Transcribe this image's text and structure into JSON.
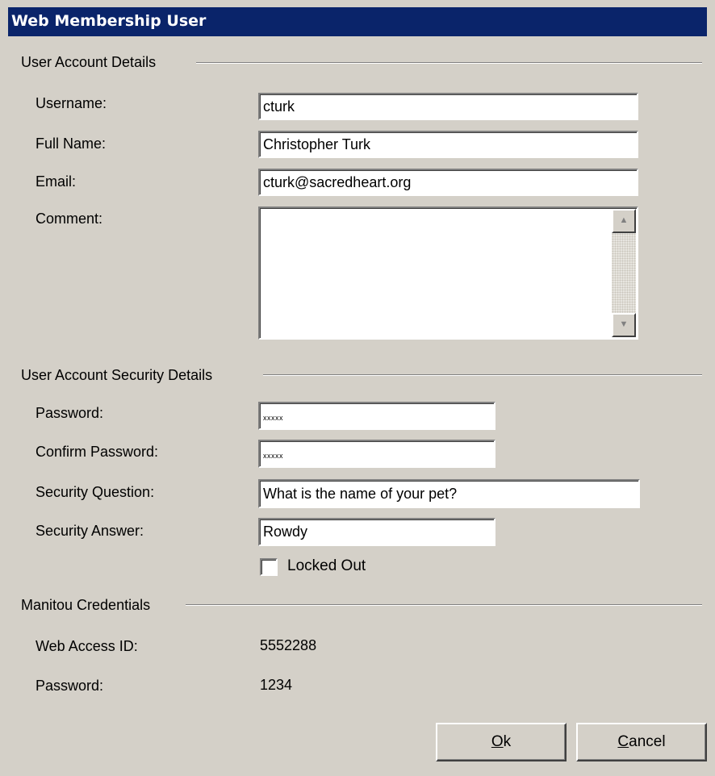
{
  "window": {
    "title": "Web Membership User"
  },
  "account_details": {
    "section_title": "User Account Details",
    "username_label": "Username:",
    "username_value": "cturk",
    "fullname_label": "Full Name:",
    "fullname_value": "Christopher Turk",
    "email_label": "Email:",
    "email_value": "cturk@sacredheart.org",
    "comment_label": "Comment:",
    "comment_value": ""
  },
  "security_details": {
    "section_title": "User Account Security Details",
    "password_label": "Password:",
    "password_value": "xxxxx",
    "confirm_password_label": "Confirm Password:",
    "confirm_password_value": "xxxxx",
    "security_question_label": "Security Question:",
    "security_question_value": "What is the name of your pet?",
    "security_answer_label": "Security Answer:",
    "security_answer_value": "Rowdy",
    "locked_out_label": "Locked Out",
    "locked_out_checked": false
  },
  "manitou_credentials": {
    "section_title": "Manitou Credentials",
    "web_access_id_label": "Web Access ID:",
    "web_access_id_value": "5552288",
    "password_label": "Password:",
    "password_value": "1234"
  },
  "buttons": {
    "ok_mnemonic": "O",
    "ok_rest": "k",
    "cancel_mnemonic": "C",
    "cancel_rest": "ancel"
  },
  "icons": {
    "scroll_up": "scroll-up-arrow-icon",
    "scroll_down": "scroll-down-arrow-icon"
  },
  "colors": {
    "titlebar": "#0a246a",
    "window_bg": "#d4d0c8",
    "field_bg": "#ffffff"
  }
}
